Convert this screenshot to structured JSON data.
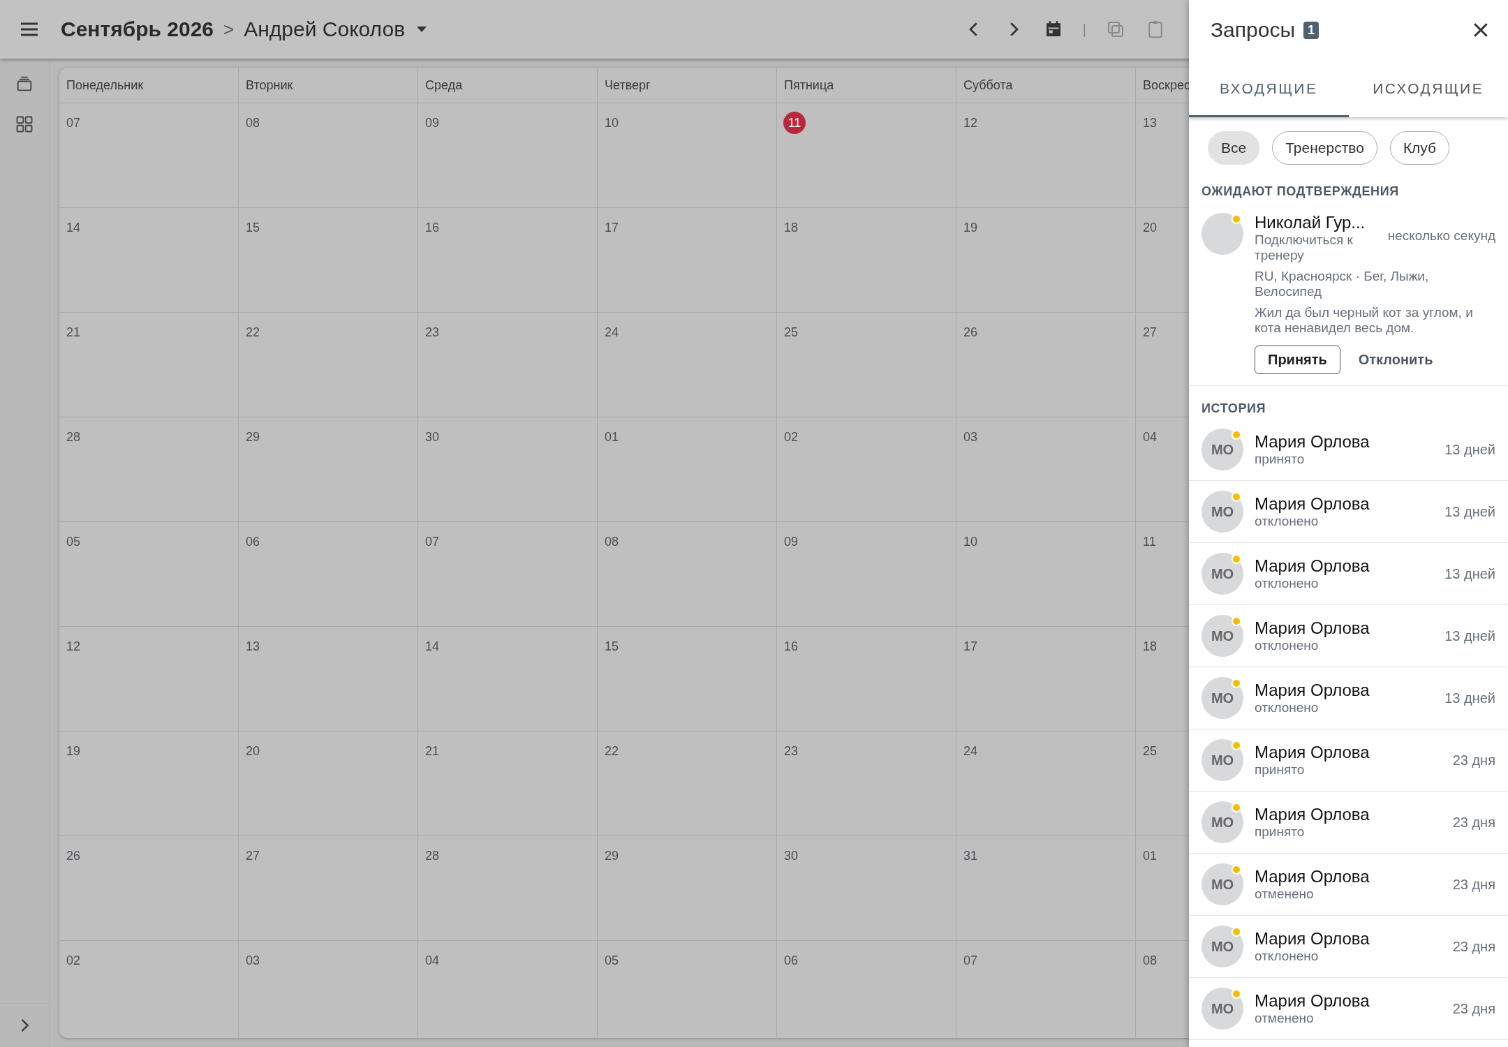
{
  "topbar": {
    "month": "Сентябрь 2026",
    "separator": ">",
    "person": "Андрей Соколов",
    "divider": "|"
  },
  "calendar": {
    "weekdays": [
      "Понедельник",
      "Вторник",
      "Среда",
      "Четверг",
      "Пятница",
      "Суббота",
      "Воскрес"
    ],
    "weeks": [
      [
        {
          "day": "07",
          "today": false
        },
        {
          "day": "08",
          "today": false
        },
        {
          "day": "09",
          "today": false
        },
        {
          "day": "10",
          "today": false
        },
        {
          "day": "11",
          "today": true
        },
        {
          "day": "12",
          "today": false
        },
        {
          "day": "13",
          "today": false
        }
      ],
      [
        {
          "day": "14",
          "today": false
        },
        {
          "day": "15",
          "today": false
        },
        {
          "day": "16",
          "today": false
        },
        {
          "day": "17",
          "today": false
        },
        {
          "day": "18",
          "today": false
        },
        {
          "day": "19",
          "today": false
        },
        {
          "day": "20",
          "today": false
        }
      ],
      [
        {
          "day": "21",
          "today": false
        },
        {
          "day": "22",
          "today": false
        },
        {
          "day": "23",
          "today": false
        },
        {
          "day": "24",
          "today": false
        },
        {
          "day": "25",
          "today": false
        },
        {
          "day": "26",
          "today": false
        },
        {
          "day": "27",
          "today": false
        }
      ],
      [
        {
          "day": "28",
          "today": false
        },
        {
          "day": "29",
          "today": false
        },
        {
          "day": "30",
          "today": false
        },
        {
          "day": "01",
          "today": false
        },
        {
          "day": "02",
          "today": false
        },
        {
          "day": "03",
          "today": false
        },
        {
          "day": "04",
          "today": false
        }
      ],
      [
        {
          "day": "05",
          "today": false
        },
        {
          "day": "06",
          "today": false
        },
        {
          "day": "07",
          "today": false
        },
        {
          "day": "08",
          "today": false
        },
        {
          "day": "09",
          "today": false
        },
        {
          "day": "10",
          "today": false
        },
        {
          "day": "11",
          "today": false
        }
      ],
      [
        {
          "day": "12",
          "today": false
        },
        {
          "day": "13",
          "today": false
        },
        {
          "day": "14",
          "today": false
        },
        {
          "day": "15",
          "today": false
        },
        {
          "day": "16",
          "today": false
        },
        {
          "day": "17",
          "today": false
        },
        {
          "day": "18",
          "today": false
        }
      ],
      [
        {
          "day": "19",
          "today": false
        },
        {
          "day": "20",
          "today": false
        },
        {
          "day": "21",
          "today": false
        },
        {
          "day": "22",
          "today": false
        },
        {
          "day": "23",
          "today": false
        },
        {
          "day": "24",
          "today": false
        },
        {
          "day": "25",
          "today": false
        }
      ],
      [
        {
          "day": "26",
          "today": false
        },
        {
          "day": "27",
          "today": false
        },
        {
          "day": "28",
          "today": false
        },
        {
          "day": "29",
          "today": false
        },
        {
          "day": "30",
          "today": false
        },
        {
          "day": "31",
          "today": false
        },
        {
          "day": "01",
          "today": false
        }
      ],
      [
        {
          "day": "02",
          "today": false
        },
        {
          "day": "03",
          "today": false
        },
        {
          "day": "04",
          "today": false
        },
        {
          "day": "05",
          "today": false
        },
        {
          "day": "06",
          "today": false
        },
        {
          "day": "07",
          "today": false
        },
        {
          "day": "08",
          "today": false
        }
      ]
    ]
  },
  "panel": {
    "title": "Запросы",
    "badge": "1",
    "tabs": [
      {
        "label": "ВХОДЯЩИЕ",
        "selected": true
      },
      {
        "label": "ИСХОДЯЩИЕ",
        "selected": false
      }
    ],
    "filters": [
      {
        "label": "Все",
        "selected": true
      },
      {
        "label": "Тренерство",
        "selected": false
      },
      {
        "label": "Клуб",
        "selected": false
      }
    ],
    "pending_title": "ОЖИДАЮТ ПОДТВЕРЖДЕНИЯ",
    "pending": [
      {
        "name": "Николай Гур...",
        "request": "Подключиться к тренеру",
        "time": "несколько секунд",
        "location": "RU, Красноярск · Бег, Лыжи, Велосипед",
        "message": "Жил да был черный кот за углом, и кота ненавидел весь дом.",
        "online": true,
        "accept": "Принять",
        "decline": "Отклонить"
      }
    ],
    "history_title": "ИСТОРИЯ",
    "history": [
      {
        "initials": "МО",
        "name": "Мария Орлова",
        "status": "принято",
        "time": "13 дней",
        "online": true
      },
      {
        "initials": "МО",
        "name": "Мария Орлова",
        "status": "отклонено",
        "time": "13 дней",
        "online": true
      },
      {
        "initials": "МО",
        "name": "Мария Орлова",
        "status": "отклонено",
        "time": "13 дней",
        "online": true
      },
      {
        "initials": "МО",
        "name": "Мария Орлова",
        "status": "отклонено",
        "time": "13 дней",
        "online": true
      },
      {
        "initials": "МО",
        "name": "Мария Орлова",
        "status": "отклонено",
        "time": "13 дней",
        "online": true
      },
      {
        "initials": "МО",
        "name": "Мария Орлова",
        "status": "принято",
        "time": "23 дня",
        "online": true
      },
      {
        "initials": "МО",
        "name": "Мария Орлова",
        "status": "принято",
        "time": "23 дня",
        "online": true
      },
      {
        "initials": "МО",
        "name": "Мария Орлова",
        "status": "отменено",
        "time": "23 дня",
        "online": true
      },
      {
        "initials": "МО",
        "name": "Мария Орлова",
        "status": "отклонено",
        "time": "23 дня",
        "online": true
      },
      {
        "initials": "МО",
        "name": "Мария Орлова",
        "status": "отменено",
        "time": "23 дня",
        "online": true
      }
    ]
  }
}
